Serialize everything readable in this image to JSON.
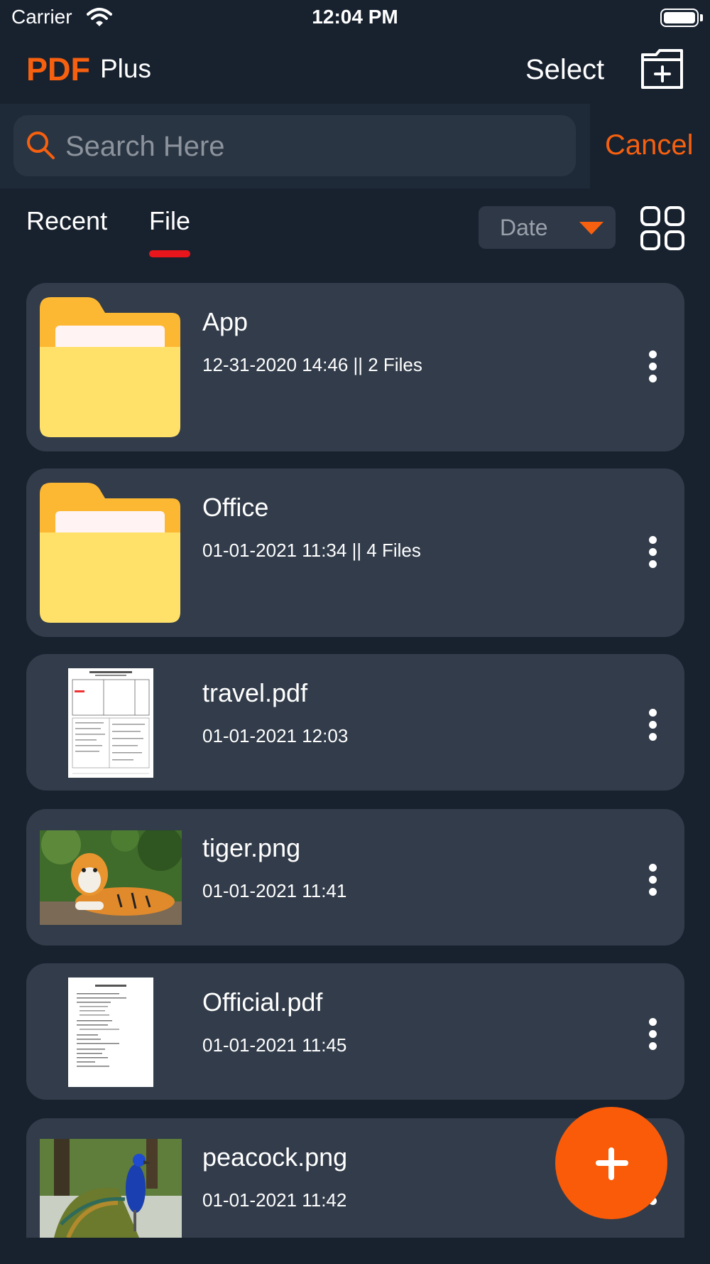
{
  "status_bar": {
    "carrier": "Carrier",
    "time": "12:04 PM"
  },
  "header": {
    "logo": "PDF",
    "logo_sub": "Plus",
    "select_label": "Select",
    "new_folder_icon": "folder-plus-icon"
  },
  "search": {
    "placeholder": "Search Here",
    "value": "",
    "cancel_label": "Cancel"
  },
  "tabs": [
    {
      "label": "Recent",
      "active": false
    },
    {
      "label": "File",
      "active": true
    }
  ],
  "sort": {
    "selected": "Date"
  },
  "colors": {
    "accent": "#f6600f",
    "background": "#18222f",
    "card": "#323c4a",
    "tab_indicator": "#e7161c",
    "folder_yellow": "#ffe16a"
  },
  "files": [
    {
      "name": "App",
      "meta": "12-31-2020 14:46 || 2 Files",
      "kind": "folder"
    },
    {
      "name": "Office",
      "meta": "01-01-2021 11:34 || 4 Files",
      "kind": "folder"
    },
    {
      "name": "travel.pdf",
      "meta": "01-01-2021 12:03",
      "kind": "pdf"
    },
    {
      "name": "tiger.png",
      "meta": "01-01-2021 11:41",
      "kind": "image"
    },
    {
      "name": "Official.pdf",
      "meta": "01-01-2021 11:45",
      "kind": "pdf"
    },
    {
      "name": "peacock.png",
      "meta": "01-01-2021 11:42",
      "kind": "image"
    }
  ],
  "fab": {
    "icon": "plus-icon"
  }
}
